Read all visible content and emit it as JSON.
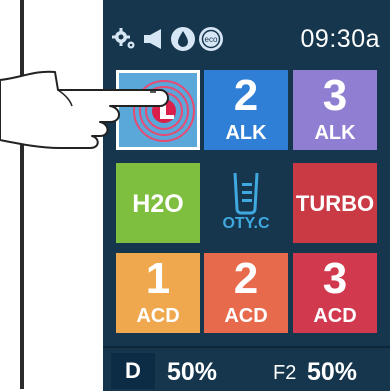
{
  "status": {
    "icons": [
      "gear-icon",
      "speaker-icon",
      "water-drop-icon",
      "eco-icon"
    ],
    "time": "09:30a"
  },
  "tiles": {
    "alk2": {
      "number": "2",
      "label": "ALK"
    },
    "alk3": {
      "number": "3",
      "label": "ALK"
    },
    "h2o": {
      "label": "H2O"
    },
    "qty": {
      "label": "OTY.C"
    },
    "turbo": {
      "label": "TURBO"
    },
    "acd1": {
      "number": "1",
      "label": "ACD"
    },
    "acd2": {
      "number": "2",
      "label": "ACD"
    },
    "acd3": {
      "number": "3",
      "label": "ACD"
    }
  },
  "bottom": {
    "mode": "D",
    "left_percent": "50%",
    "f_label": "F2",
    "right_percent": "50%"
  },
  "colors": {
    "panel": "#15364d",
    "alk2": "#2f7fd6",
    "alk3": "#8f7ed2",
    "h2o": "#7fbf3f",
    "turbo": "#c93a45",
    "acd1": "#f0a84e",
    "acd2": "#e86a4d",
    "acd3": "#d1394f",
    "selected": "#5aa7d9"
  }
}
